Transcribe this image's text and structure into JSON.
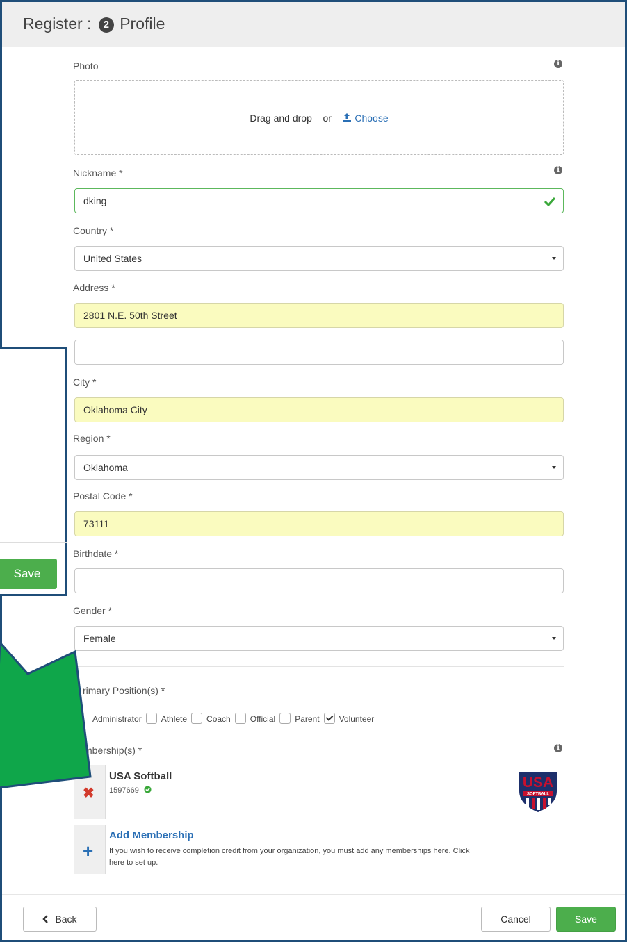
{
  "header": {
    "title_prefix": "Register :",
    "step": "2",
    "title": "Profile"
  },
  "photo": {
    "label": "Photo",
    "drag_text": "Drag and drop",
    "or_text": "or",
    "choose_label": "Choose"
  },
  "nickname": {
    "label": "Nickname *",
    "value": "dking"
  },
  "country": {
    "label": "Country *",
    "value": "United States"
  },
  "address": {
    "label": "Address *",
    "line1": "2801 N.E. 50th Street",
    "line2": ""
  },
  "city": {
    "label": "City *",
    "value": "Oklahoma City"
  },
  "region": {
    "label": "Region *",
    "value": "Oklahoma"
  },
  "postal": {
    "label": "Postal Code *",
    "value": "73111"
  },
  "birthdate": {
    "label": "Birthdate *",
    "value": ""
  },
  "gender": {
    "label": "Gender *",
    "value": "Female"
  },
  "positions": {
    "label": "rimary Position(s) *",
    "options": [
      {
        "label": "Administrator",
        "checked": false
      },
      {
        "label": "Athlete",
        "checked": false
      },
      {
        "label": "Coach",
        "checked": false
      },
      {
        "label": "Official",
        "checked": false
      },
      {
        "label": "Parent",
        "checked": true
      },
      {
        "label": "Volunteer",
        "checked": false
      }
    ]
  },
  "memberships": {
    "label": "mbership(s) *",
    "items": [
      {
        "org": "USA Softball",
        "number": "1597669"
      }
    ],
    "add_title": "Add Membership",
    "add_desc_1": "If you wish to receive completion credit from your organization, you must add any memberships here. Click",
    "add_desc_2": "here to set up."
  },
  "logo": {
    "top": "USA",
    "bottom": "SOFTBALL"
  },
  "footer": {
    "back_label": "Back",
    "cancel_label": "Cancel",
    "save_label": "Save"
  },
  "overlay": {
    "save_label": "Save"
  },
  "colors": {
    "frame": "#1f4e79",
    "arrow": "#0fa64a",
    "save": "#4cae4c",
    "yellow_field": "#fafbbf",
    "link": "#2a6fb5"
  },
  "icons": [
    "info-icon",
    "upload-icon",
    "check-icon",
    "remove-icon",
    "plus-icon",
    "chevron-left-icon"
  ]
}
